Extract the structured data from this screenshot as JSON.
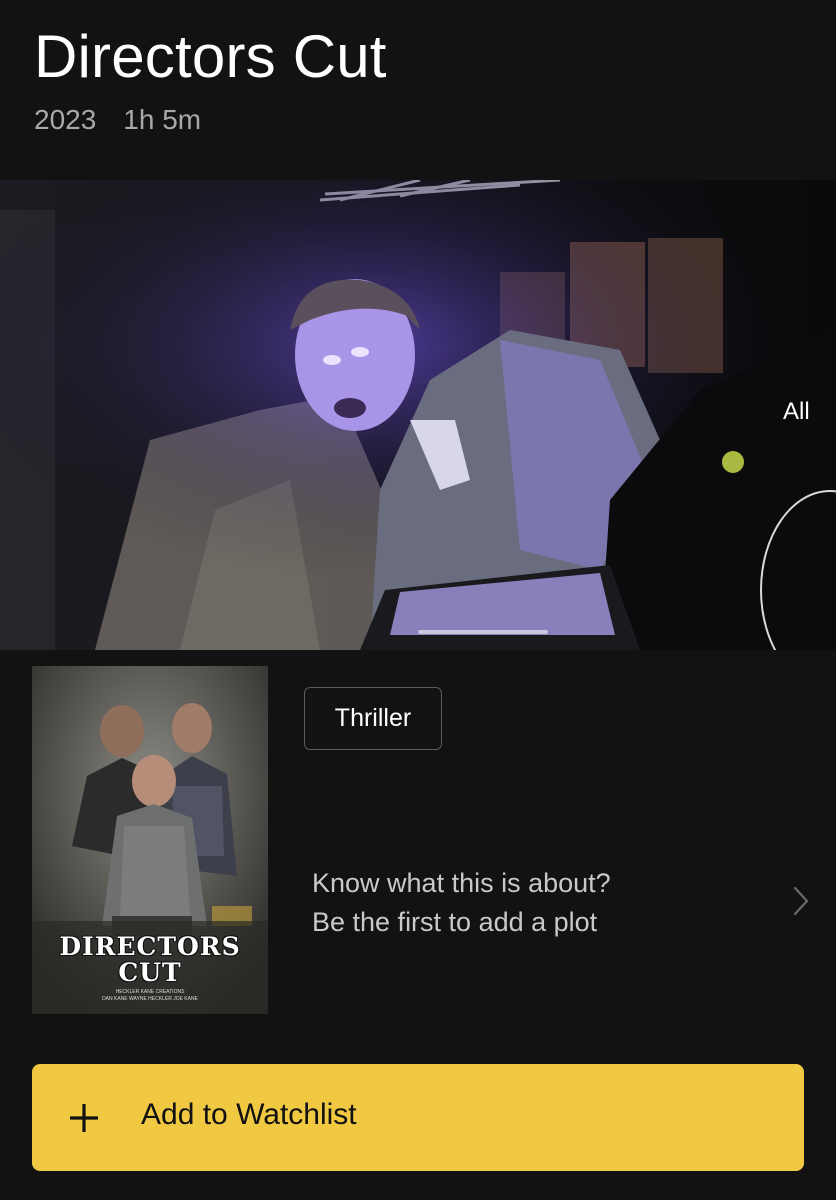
{
  "header": {
    "title": "Directors Cut",
    "year": "2023",
    "runtime": "1h 5m"
  },
  "hero": {
    "all_label": "All"
  },
  "poster": {
    "title_line1": "DIRECTORS",
    "title_line2": "CUT",
    "credit_line1": "HECKLER KANE CREATIONS",
    "credit_line2": "DAN KANE   WAYNE HECKLER   JOE KANE"
  },
  "genres": [
    "Thriller"
  ],
  "plot_prompt": {
    "line1": "Know what this is about?",
    "line2": "Be the first to add a plot"
  },
  "watchlist_button": {
    "label": "Add to Watchlist"
  },
  "colors": {
    "background": "#121212",
    "accent": "#f0c842",
    "secondary_text": "#a8a8a8"
  },
  "icons": {
    "chevron": "chevron-right-icon",
    "plus": "plus-icon"
  }
}
